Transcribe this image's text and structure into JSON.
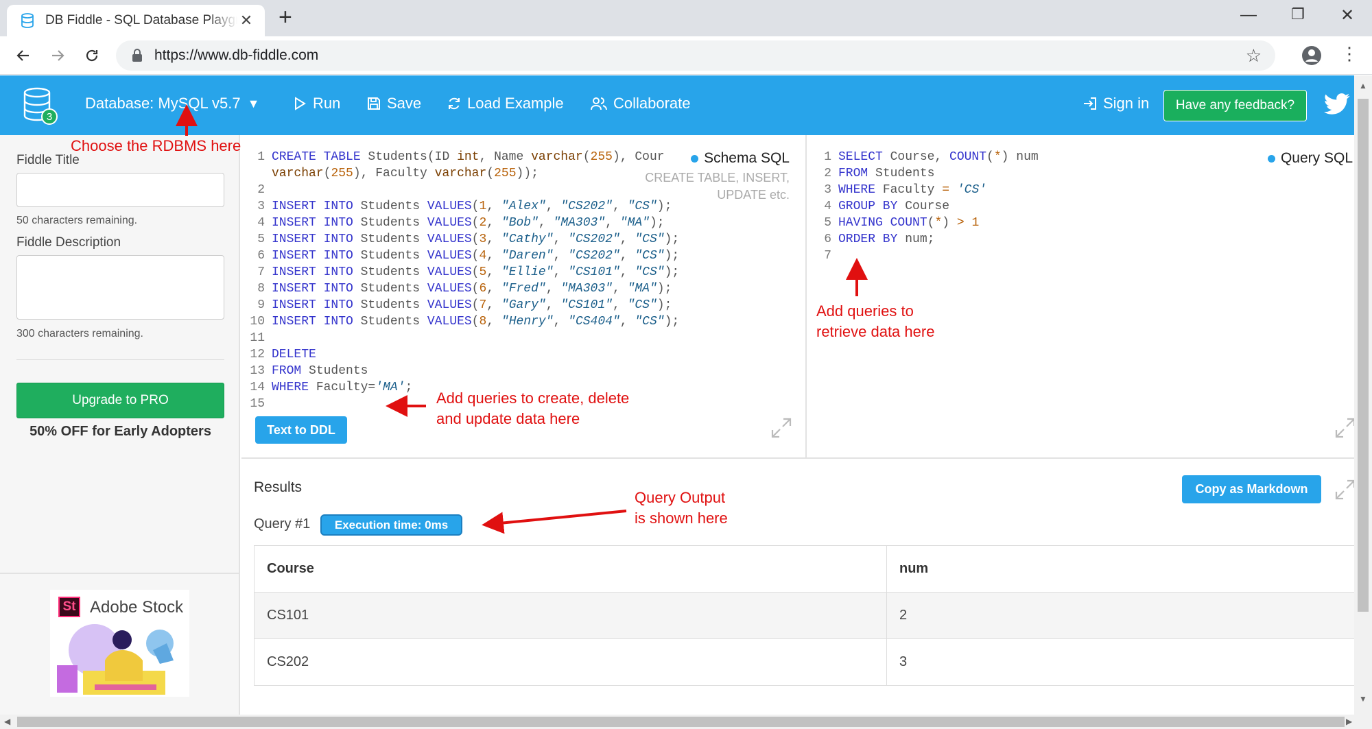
{
  "browser": {
    "tab_title": "DB Fiddle - SQL Database Playground",
    "url": "https://www.db-fiddle.com",
    "new_tab": "+",
    "minimize": "—",
    "restore": "❐",
    "close": "✕"
  },
  "header": {
    "db_badge": "3",
    "database_label": "Database: MySQL v5.7",
    "run": "Run",
    "save": "Save",
    "load_example": "Load Example",
    "collaborate": "Collaborate",
    "sign_in": "Sign in",
    "feedback": "Have any feedback?",
    "accent": "#28a4ea"
  },
  "sidebar": {
    "title_label": "Fiddle Title",
    "title_value": "",
    "title_hint": "50 characters remaining.",
    "description_label": "Fiddle Description",
    "description_value": "",
    "description_hint": "300 characters remaining.",
    "upgrade": "Upgrade to PRO",
    "promo": "50% OFF for Early Adopters",
    "ad_logo": "St",
    "ad_brand": "Adobe Stock"
  },
  "schema_editor": {
    "tag": "Schema SQL",
    "subtitle_1": "CREATE TABLE, INSERT,",
    "subtitle_2": "UPDATE etc.",
    "text_to_ddl": "Text to DDL"
  },
  "query_editor": {
    "tag": "Query SQL"
  },
  "results": {
    "title": "Results",
    "copy_markdown": "Copy as Markdown",
    "query_label": "Query #1",
    "execution": "Execution time: 0ms",
    "headers": [
      "Course",
      "num"
    ],
    "rows": [
      [
        "CS101",
        "2"
      ],
      [
        "CS202",
        "3"
      ]
    ]
  },
  "annotations": {
    "rdbms": "Choose the RDBMS here",
    "schema_1": "Add queries to create, delete",
    "schema_2": "and update data here",
    "query_1": "Add queries to",
    "query_2": "retrieve data here",
    "output_1": "Query Output",
    "output_2": "is shown here"
  }
}
